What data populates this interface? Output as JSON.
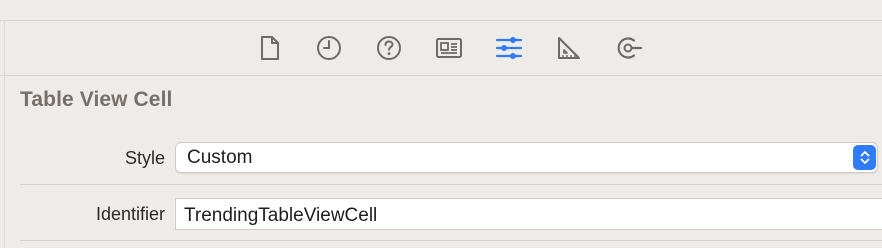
{
  "inspector_tabs": [
    {
      "icon": "file-inspector-icon",
      "active": false
    },
    {
      "icon": "history-inspector-icon",
      "active": false
    },
    {
      "icon": "quick-help-icon",
      "active": false
    },
    {
      "icon": "identity-inspector-icon",
      "active": false
    },
    {
      "icon": "attributes-inspector-icon",
      "active": true
    },
    {
      "icon": "size-inspector-icon",
      "active": false
    },
    {
      "icon": "connections-inspector-icon",
      "active": false
    }
  ],
  "section": {
    "title": "Table View Cell"
  },
  "style": {
    "label": "Style",
    "value": "Custom"
  },
  "identifier": {
    "label": "Identifier",
    "value": "TrendingTableViewCell"
  },
  "colors": {
    "accent": "#2f7cf6",
    "icon": "#6f6a66",
    "background": "#efebe8"
  }
}
